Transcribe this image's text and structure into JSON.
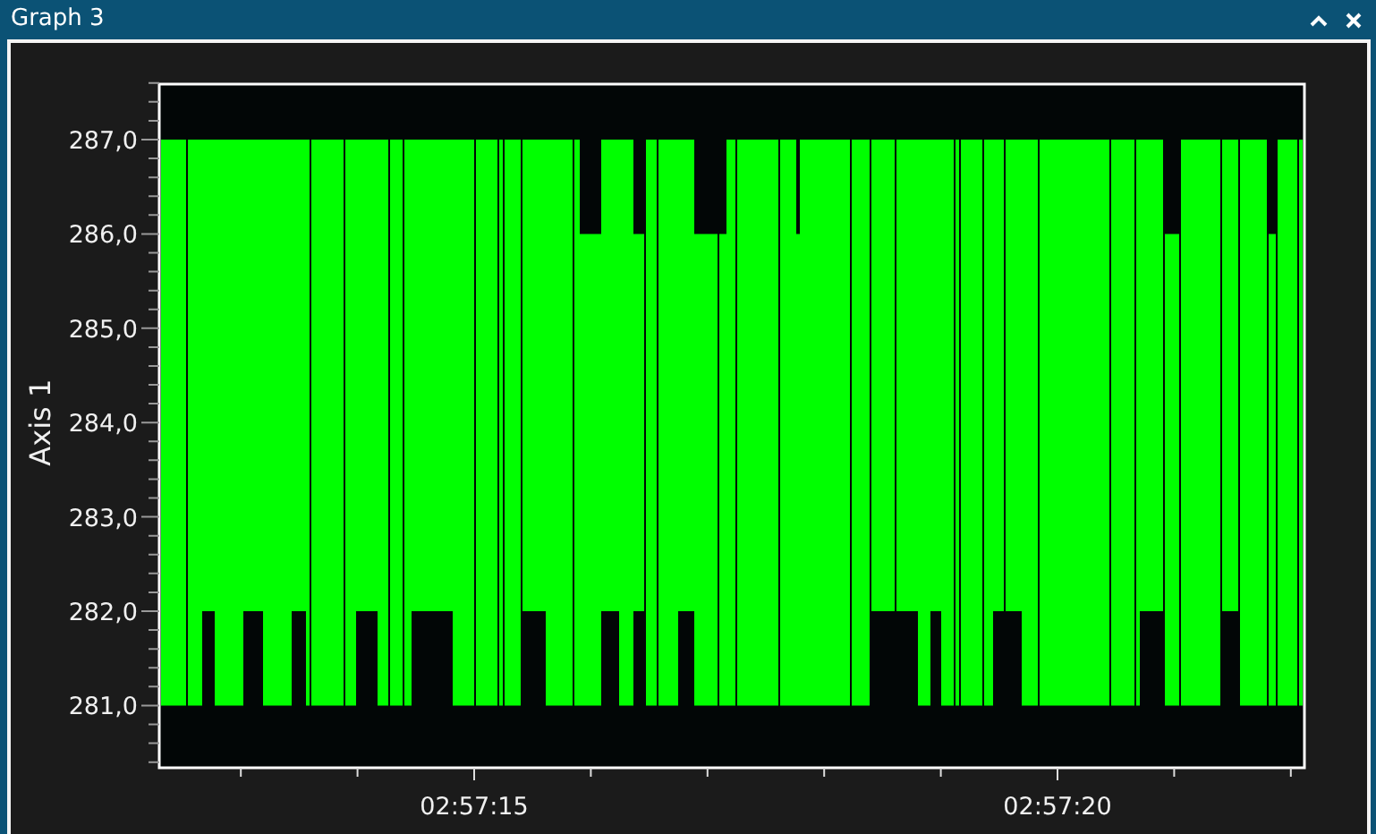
{
  "window": {
    "title": "Graph 3"
  },
  "graph": {
    "y_axis": {
      "title": "Axis 1",
      "ticks": [
        "287,0",
        "286,0",
        "285,0",
        "284,0",
        "283,0",
        "282,0",
        "281,0"
      ]
    },
    "x_axis": {
      "ticks": [
        "02:57:15",
        "02:57:20"
      ]
    }
  }
}
